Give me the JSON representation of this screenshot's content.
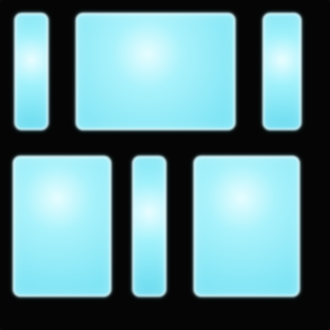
{
  "icon": {
    "name": "grid-layout-icon",
    "colors": {
      "background": "#050505",
      "tile_fill": "#7de6f6",
      "tile_highlight": "#ffffff",
      "tile_mid": "#9ff1fb"
    },
    "rows": [
      {
        "name": "top-row",
        "tiles": [
          "narrow",
          "wide",
          "narrow"
        ]
      },
      {
        "name": "bottom-row",
        "tiles": [
          "wide",
          "narrow",
          "wide"
        ]
      }
    ]
  }
}
